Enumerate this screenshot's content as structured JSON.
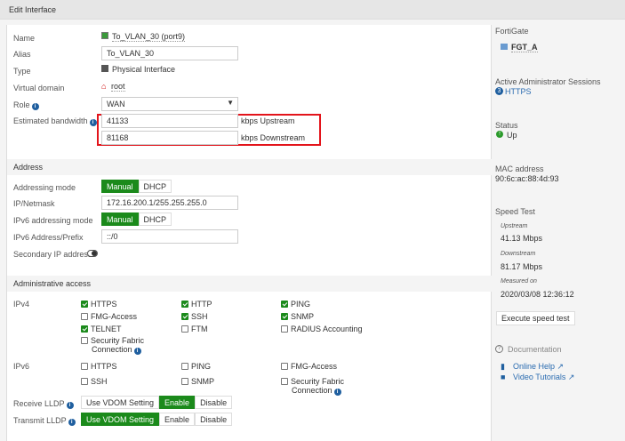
{
  "header": {
    "title": "Edit Interface"
  },
  "form": {
    "name_label": "Name",
    "name_value": "To_VLAN_30 (port9)",
    "alias_label": "Alias",
    "alias_value": "To_VLAN_30",
    "type_label": "Type",
    "type_value": "Physical Interface",
    "vdom_label": "Virtual domain",
    "vdom_value": "root",
    "role_label": "Role",
    "role_value": "WAN",
    "bw_label": "Estimated bandwidth",
    "upstream_value": "41133",
    "upstream_unit": "kbps Upstream",
    "downstream_value": "81168",
    "downstream_unit": "kbps Downstream"
  },
  "address": {
    "title": "Address",
    "mode_label": "Addressing mode",
    "manual": "Manual",
    "dhcp": "DHCP",
    "ip_label": "IP/Netmask",
    "ip_value": "172.16.200.1/255.255.255.0",
    "ipv6_mode_label": "IPv6 addressing mode",
    "ipv6_prefix_label": "IPv6 Address/Prefix",
    "ipv6_prefix_value": "::/0",
    "secondary_label": "Secondary IP address"
  },
  "admin": {
    "title": "Administrative access",
    "ipv4_label": "IPv4",
    "ipv6_label": "IPv6",
    "ipv4": [
      {
        "label": "HTTPS",
        "checked": true
      },
      {
        "label": "HTTP",
        "checked": true
      },
      {
        "label": "PING",
        "checked": true
      },
      {
        "label": "FMG-Access",
        "checked": false
      },
      {
        "label": "SSH",
        "checked": true
      },
      {
        "label": "SNMP",
        "checked": true
      },
      {
        "label": "TELNET",
        "checked": true
      },
      {
        "label": "FTM",
        "checked": false
      },
      {
        "label": "RADIUS Accounting",
        "checked": false
      },
      {
        "label": "Security Fabric",
        "label2": "Connection",
        "checked": false
      }
    ],
    "ipv6": [
      {
        "label": "HTTPS",
        "checked": false
      },
      {
        "label": "PING",
        "checked": false
      },
      {
        "label": "FMG-Access",
        "checked": false
      },
      {
        "label": "SSH",
        "checked": false
      },
      {
        "label": "SNMP",
        "checked": false
      },
      {
        "label": "Security Fabric",
        "label2": "Connection",
        "checked": false
      }
    ],
    "rx_lldp_label": "Receive LLDP",
    "tx_lldp_label": "Transmit LLDP",
    "use_vdom": "Use VDOM Setting",
    "enable": "Enable",
    "disable": "Disable"
  },
  "sidebar": {
    "fortigate_label": "FortiGate",
    "fortigate_value": "FGT_A",
    "sessions_label": "Active Administrator Sessions",
    "sessions_count": "3",
    "sessions_value": "HTTPS",
    "status_label": "Status",
    "status_value": "Up",
    "mac_label": "MAC address",
    "mac_value": "90:6c:ac:88:4d:93",
    "speed_label": "Speed Test",
    "up_label": "Upstream",
    "up_value": "41.13 Mbps",
    "down_label": "Downstream",
    "down_value": "81.17 Mbps",
    "measured_label": "Measured on",
    "measured_value": "2020/03/08 12:36:12",
    "execute_button": "Execute speed test",
    "doc_label": "Documentation",
    "online_help": "Online Help",
    "video_tutorials": "Video Tutorials"
  },
  "colors": {
    "accent": "#1b8a1b",
    "link": "#2a6bb0",
    "highlight": "#e3141b"
  }
}
